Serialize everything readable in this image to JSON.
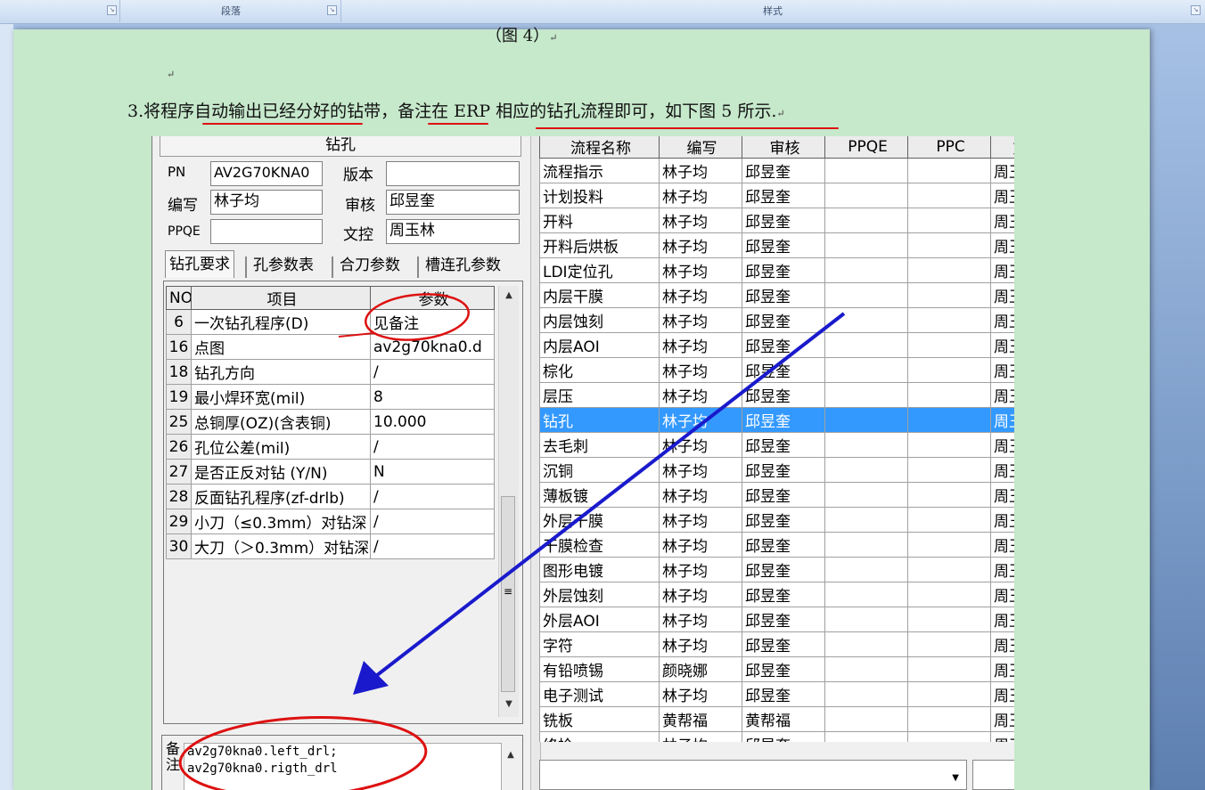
{
  "ribbon": {
    "groups": [
      {
        "label": ""
      },
      {
        "label": "段落"
      },
      {
        "label": "样式"
      }
    ]
  },
  "doc": {
    "caption": "（图 4）",
    "para_prefix": "3.",
    "para_text": "将程序自动输出已经分好的钻带，备注在 ERP 相应的钻孔流程即可，如下图 5 所示."
  },
  "app": {
    "panel_title": "钻孔",
    "fields": [
      {
        "label": "PN",
        "value": "AV2G70KNA0"
      },
      {
        "label": "版本",
        "value": ""
      },
      {
        "label": "编写",
        "value": "林子均"
      },
      {
        "label": "审核",
        "value": "邱昱奎"
      },
      {
        "label": "PPQE",
        "value": ""
      },
      {
        "label": "文控",
        "value": "周玉林"
      }
    ],
    "tabs": [
      "钻孔要求",
      "孔参数表",
      "合刀参数",
      "槽连孔参数"
    ],
    "left_headers": [
      "NO",
      "项目",
      "参数"
    ],
    "left_rows": [
      {
        "no": "6",
        "item": "一次钻孔程序(D)",
        "param": "见备注"
      },
      {
        "no": "16",
        "item": "点图",
        "param": "av2g70kna0.d"
      },
      {
        "no": "18",
        "item": "钻孔方向",
        "param": "/"
      },
      {
        "no": "19",
        "item": "最小焊环宽(mil)",
        "param": "8"
      },
      {
        "no": "25",
        "item": "总铜厚(OZ)(含表铜)",
        "param": "10.000"
      },
      {
        "no": "26",
        "item": "孔位公差(mil)",
        "param": "/"
      },
      {
        "no": "27",
        "item": "是否正反对钻 (Y/N)",
        "param": "N"
      },
      {
        "no": "28",
        "item": "反面钻孔程序(zf-drlb)",
        "param": "/"
      },
      {
        "no": "29",
        "item": "小刀（≤0.3mm）对钻深",
        "param": "/"
      },
      {
        "no": "30",
        "item": "大刀（＞0.3mm）对钻深",
        "param": "/"
      }
    ],
    "remark_label": "备注",
    "remark_lines": [
      "av2g70kna0.left_drl;",
      "av2g70kna0.rigth_drl"
    ],
    "right_headers": [
      "流程名称",
      "编写",
      "审核",
      "PPQE",
      "PPC",
      "文"
    ],
    "right_rows": [
      {
        "name": "流程指示",
        "author": "林子均",
        "reviewer": "邱昱奎",
        "ppqe": "",
        "ppc": "",
        "dc": "周玉"
      },
      {
        "name": "计划投料",
        "author": "林子均",
        "reviewer": "邱昱奎",
        "ppqe": "",
        "ppc": "",
        "dc": "周玉"
      },
      {
        "name": "开料",
        "author": "林子均",
        "reviewer": "邱昱奎",
        "ppqe": "",
        "ppc": "",
        "dc": "周玉"
      },
      {
        "name": "开料后烘板",
        "author": "林子均",
        "reviewer": "邱昱奎",
        "ppqe": "",
        "ppc": "",
        "dc": "周玉"
      },
      {
        "name": "LDI定位孔",
        "author": "林子均",
        "reviewer": "邱昱奎",
        "ppqe": "",
        "ppc": "",
        "dc": "周玉"
      },
      {
        "name": "内层干膜",
        "author": "林子均",
        "reviewer": "邱昱奎",
        "ppqe": "",
        "ppc": "",
        "dc": "周玉"
      },
      {
        "name": "内层蚀刻",
        "author": "林子均",
        "reviewer": "邱昱奎",
        "ppqe": "",
        "ppc": "",
        "dc": "周玉"
      },
      {
        "name": "内层AOI",
        "author": "林子均",
        "reviewer": "邱昱奎",
        "ppqe": "",
        "ppc": "",
        "dc": "周玉"
      },
      {
        "name": "棕化",
        "author": "林子均",
        "reviewer": "邱昱奎",
        "ppqe": "",
        "ppc": "",
        "dc": "周玉"
      },
      {
        "name": "层压",
        "author": "林子均",
        "reviewer": "邱昱奎",
        "ppqe": "",
        "ppc": "",
        "dc": "周玉"
      },
      {
        "name": "钻孔",
        "author": "林子均",
        "reviewer": "邱昱奎",
        "ppqe": "",
        "ppc": "",
        "dc": "周玉"
      },
      {
        "name": "去毛刺",
        "author": "林子均",
        "reviewer": "邱昱奎",
        "ppqe": "",
        "ppc": "",
        "dc": "周玉"
      },
      {
        "name": "沉铜",
        "author": "林子均",
        "reviewer": "邱昱奎",
        "ppqe": "",
        "ppc": "",
        "dc": "周玉"
      },
      {
        "name": "薄板镀",
        "author": "林子均",
        "reviewer": "邱昱奎",
        "ppqe": "",
        "ppc": "",
        "dc": "周玉"
      },
      {
        "name": "外层干膜",
        "author": "林子均",
        "reviewer": "邱昱奎",
        "ppqe": "",
        "ppc": "",
        "dc": "周玉"
      },
      {
        "name": "干膜检查",
        "author": "林子均",
        "reviewer": "邱昱奎",
        "ppqe": "",
        "ppc": "",
        "dc": "周玉"
      },
      {
        "name": "图形电镀",
        "author": "林子均",
        "reviewer": "邱昱奎",
        "ppqe": "",
        "ppc": "",
        "dc": "周玉"
      },
      {
        "name": "外层蚀刻",
        "author": "林子均",
        "reviewer": "邱昱奎",
        "ppqe": "",
        "ppc": "",
        "dc": "周玉"
      },
      {
        "name": "外层AOI",
        "author": "林子均",
        "reviewer": "邱昱奎",
        "ppqe": "",
        "ppc": "",
        "dc": "周玉"
      },
      {
        "name": "字符",
        "author": "林子均",
        "reviewer": "邱昱奎",
        "ppqe": "",
        "ppc": "",
        "dc": "周玉"
      },
      {
        "name": "有铅喷锡",
        "author": "颜晓娜",
        "reviewer": "邱昱奎",
        "ppqe": "",
        "ppc": "",
        "dc": "周玉"
      },
      {
        "name": "电子测试",
        "author": "林子均",
        "reviewer": "邱昱奎",
        "ppqe": "",
        "ppc": "",
        "dc": "周玉"
      },
      {
        "name": "铣板",
        "author": "黄帮福",
        "reviewer": "黄帮福",
        "ppqe": "",
        "ppc": "",
        "dc": "周玉"
      },
      {
        "name": "终检",
        "author": "林子均",
        "reviewer": "邱昱奎",
        "ppqe": "",
        "ppc": "",
        "dc": "周玉"
      }
    ],
    "selected_row": 10,
    "colors": {
      "selection": "#3399ff",
      "annotation_red": "#dd1111",
      "annotation_arrow": "#1a1acc",
      "page_bg": "#c6e8cb"
    }
  }
}
